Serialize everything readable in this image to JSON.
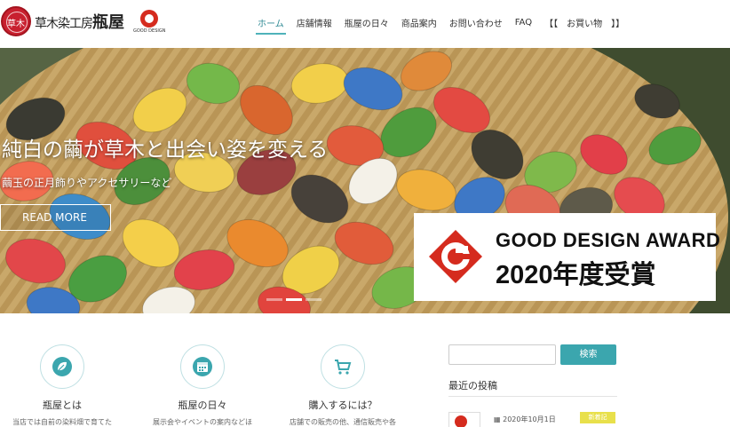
{
  "header": {
    "seal_text": "草木",
    "brand_prefix": "草木染工房",
    "brand_name": "瓶屋",
    "gmark_text": "GOOD DESIGN",
    "nav": [
      {
        "label": "ホーム",
        "active": true
      },
      {
        "label": "店舗情報"
      },
      {
        "label": "瓶屋の日々"
      },
      {
        "label": "商品案内"
      },
      {
        "label": "お問い合わせ"
      },
      {
        "label": "FAQ"
      },
      {
        "label": "【【　お買い物　】】"
      }
    ]
  },
  "hero": {
    "title": "純白の繭が草木と出会い姿を変える",
    "subtitle": "繭玉の正月飾りやアクセサリーなど",
    "read_more": "READ MORE",
    "award_line1": "GOOD DESIGN AWARD",
    "award_line2": "2020年度受賞"
  },
  "features": [
    {
      "title": "瓶屋とは",
      "text": "当店では自前の染料畑で育てた",
      "icon": "leaf-icon"
    },
    {
      "title": "瓶屋の日々",
      "text": "展示会やイベントの案内などほ",
      "icon": "calendar-icon"
    },
    {
      "title": "購入するには？",
      "text": "店舗での販売の他、通信販売や各",
      "icon": "cart-icon"
    }
  ],
  "sidebar": {
    "search_placeholder": "",
    "search_button": "検索",
    "recent_heading": "最近の投稿",
    "post_date": "2020年10月1日",
    "post_badge": "新着記"
  },
  "colors": {
    "accent": "#3ba6ae",
    "brand_red": "#c8202f",
    "badge": "#e8e04b"
  }
}
